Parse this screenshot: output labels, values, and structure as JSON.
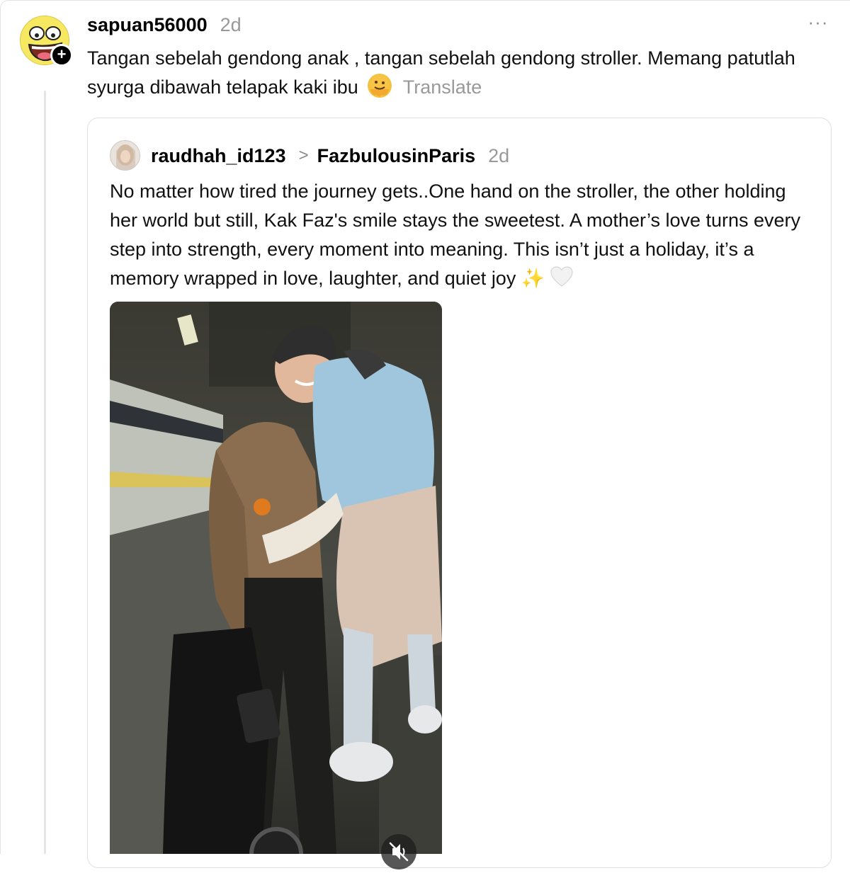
{
  "post": {
    "username": "sapuan56000",
    "time": "2d",
    "more": "···",
    "text": "Tangan sebelah gendong anak , tangan sebelah gendong stroller. Memang patutlah syurga dibawah telapak kaki ibu",
    "translate_label": "Translate",
    "follow_symbol": "+",
    "avatar_icon": "awesome-face-icon"
  },
  "quote": {
    "username": "raudhah_id123",
    "chevron": ">",
    "reply_to": "FazbulousinParis",
    "time": "2d",
    "text": "No matter how tired the journey gets..One hand on the stroller, the other holding her world but still, Kak Faz's smile stays the sweetest. A mother’s love turns every step into strength, every moment into meaning. This isn’t just a holiday, it’s a memory wrapped in love, laughter, and quiet joy",
    "sparkles": "✨"
  },
  "colors": {
    "muted": "#999999",
    "border": "#e0e0e0",
    "avatar_yellow": "#f5e65a"
  }
}
